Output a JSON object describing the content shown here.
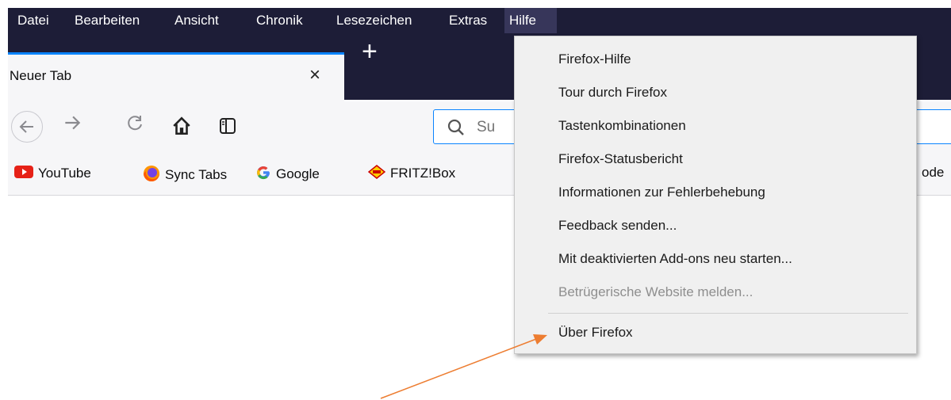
{
  "menubar": {
    "items": [
      {
        "label": "Datei"
      },
      {
        "label": "Bearbeiten"
      },
      {
        "label": "Ansicht"
      },
      {
        "label": "Chronik"
      },
      {
        "label": "Lesezeichen"
      },
      {
        "label": "Extras"
      },
      {
        "label": "Hilfe"
      }
    ]
  },
  "tab": {
    "title": "Neuer Tab",
    "close_icon": "×",
    "new_tab_icon": "+"
  },
  "urlbar": {
    "placeholder": "Su"
  },
  "bookmarks": {
    "items": [
      {
        "label": "YouTube",
        "icon": "youtube-icon"
      },
      {
        "label": "Sync Tabs",
        "icon": "firefox-icon"
      },
      {
        "label": "Google",
        "icon": "google-icon"
      },
      {
        "label": "FRITZ!Box",
        "icon": "fritzbox-icon"
      },
      {
        "label": "ode",
        "icon": ""
      }
    ]
  },
  "help_menu": {
    "items": [
      {
        "label": "Firefox-Hilfe",
        "enabled": true
      },
      {
        "label": "Tour durch Firefox",
        "enabled": true
      },
      {
        "label": "Tastenkombinationen",
        "enabled": true
      },
      {
        "label": "Firefox-Statusbericht",
        "enabled": true
      },
      {
        "label": "Informationen zur Fehlerbehebung",
        "enabled": true
      },
      {
        "label": "Feedback senden...",
        "enabled": true
      },
      {
        "label": "Mit deaktivierten Add-ons neu starten...",
        "enabled": true
      },
      {
        "label": "Betrügerische Website melden...",
        "enabled": false
      },
      {
        "label": "Über Firefox",
        "enabled": true
      }
    ]
  },
  "colors": {
    "menubar_bg": "#1d1d37",
    "active_menu_bg": "#37365a",
    "tab_accent": "#0a84ff",
    "toolbar_bg": "#f6f6f8",
    "menu_bg": "#f0f0f0",
    "annotation_arrow": "#ed7d31"
  }
}
